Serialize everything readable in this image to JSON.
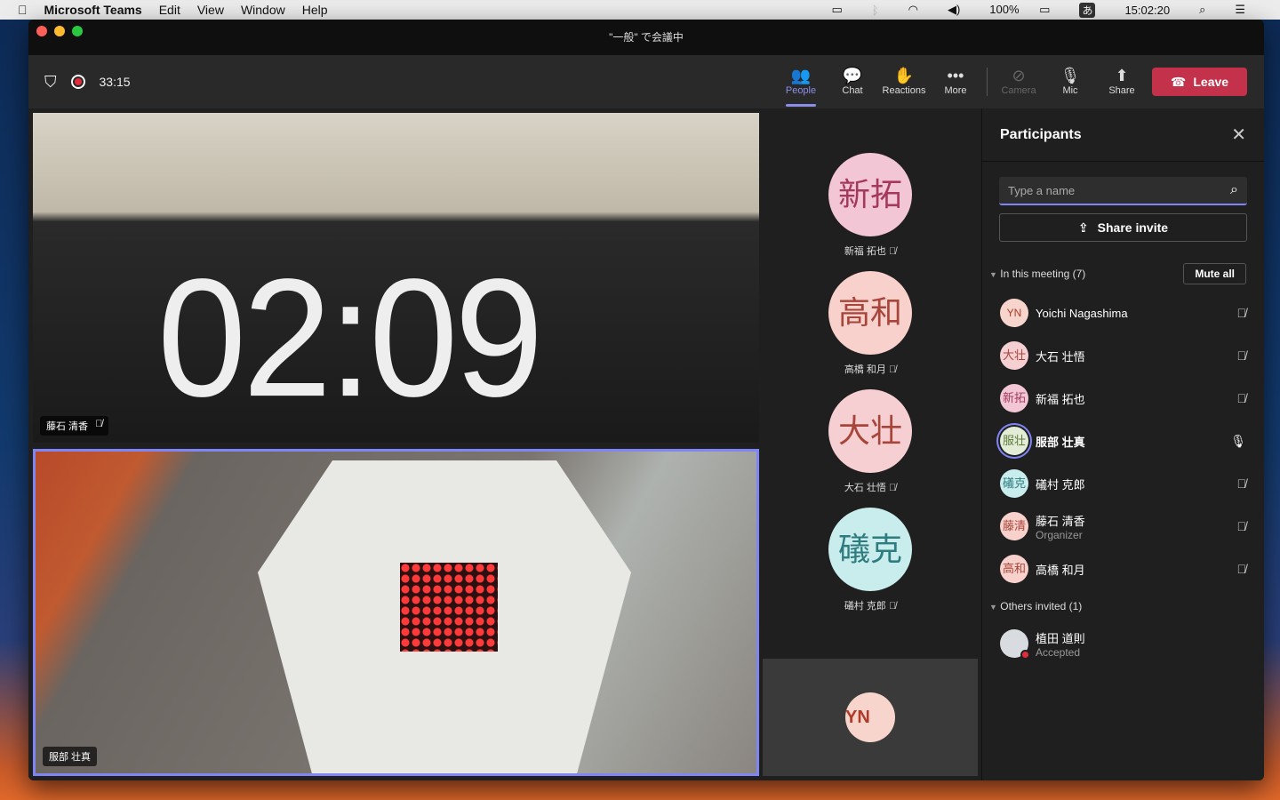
{
  "menubar": {
    "apple": "",
    "app": "Microsoft Teams",
    "items": [
      "Edit",
      "View",
      "Window",
      "Help"
    ],
    "battery": "100%",
    "ime": "あ",
    "time": "15:02:20"
  },
  "window": {
    "title": "\"一般\" で会議中"
  },
  "toolbar": {
    "timer": "33:15",
    "tools": [
      {
        "label": "People",
        "icon": "👥"
      },
      {
        "label": "Chat",
        "icon": "💬"
      },
      {
        "label": "Reactions",
        "icon": "✋"
      },
      {
        "label": "More",
        "icon": "•••"
      },
      {
        "label": "Camera",
        "icon": "📷"
      },
      {
        "label": "Mic",
        "icon": "🎙"
      },
      {
        "label": "Share",
        "icon": "⬆"
      }
    ],
    "leave": "Leave"
  },
  "videos": [
    {
      "name": "藤石 清香",
      "clock": "02:09"
    },
    {
      "name": "服部 壮真"
    }
  ],
  "gallery": [
    {
      "initials": "新拓",
      "name": "新福 拓也",
      "bg": "#f3c6d6",
      "fg": "#a33a5e"
    },
    {
      "initials": "高和",
      "name": "高橋 和月",
      "bg": "#f8d0cc",
      "fg": "#a8453a"
    },
    {
      "initials": "大壮",
      "name": "大石 壮悟",
      "bg": "#f6cfd3",
      "fg": "#a8453a"
    },
    {
      "initials": "礒克",
      "name": "礒村 克郎",
      "bg": "#c9ecec",
      "fg": "#2e7c80"
    }
  ],
  "self": {
    "initials": "YN"
  },
  "panel": {
    "title": "Participants",
    "search_placeholder": "Type a name",
    "share_invite": "Share invite",
    "in_meeting": "In this meeting (7)",
    "mute_all": "Mute all",
    "others": "Others invited (1)",
    "participants": [
      {
        "initials": "YN",
        "name": "Yoichi Nagashima",
        "bg": "#f8d5cc",
        "fg": "#b23a2a",
        "sub": ""
      },
      {
        "initials": "大壮",
        "name": "大石 壮悟",
        "bg": "#f6cfd3",
        "fg": "#a8453a",
        "sub": ""
      },
      {
        "initials": "新拓",
        "name": "新福 拓也",
        "bg": "#f3c6d6",
        "fg": "#a33a5e",
        "sub": ""
      },
      {
        "initials": "服壮",
        "name": "服部 壮真",
        "bg": "#e2ecd6",
        "fg": "#5c7a3a",
        "sub": ""
      },
      {
        "initials": "礒克",
        "name": "礒村 克郎",
        "bg": "#c9ecec",
        "fg": "#2e7c80",
        "sub": ""
      },
      {
        "initials": "藤清",
        "name": "藤石 清香",
        "bg": "#f8d0cc",
        "fg": "#a8453a",
        "sub": "Organizer"
      },
      {
        "initials": "高和",
        "name": "高橋 和月",
        "bg": "#f8d0cc",
        "fg": "#a8453a",
        "sub": ""
      }
    ],
    "invited": [
      {
        "name": "植田 道則",
        "sub": "Accepted"
      }
    ]
  }
}
